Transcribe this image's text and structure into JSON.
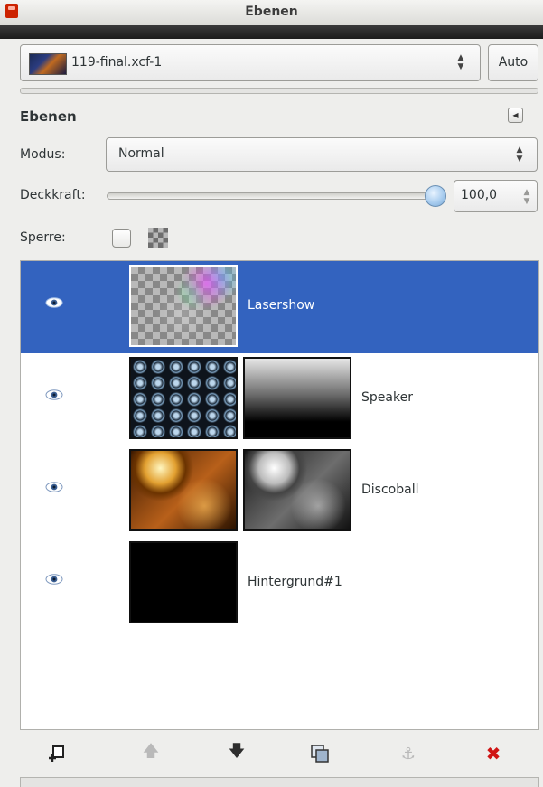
{
  "window": {
    "title": "Ebenen"
  },
  "image_selector": {
    "name": "119-final.xcf-1",
    "auto_label": "Auto"
  },
  "panel": {
    "title": "Ebenen",
    "mode": {
      "label": "Modus:",
      "value": "Normal"
    },
    "opacity": {
      "label": "Deckkraft:",
      "value": "100,0",
      "fraction": 1.0
    },
    "lock": {
      "label": "Sperre:"
    }
  },
  "layers": [
    {
      "name": "Lasershow",
      "selected": true,
      "visible": true,
      "has_mask": false
    },
    {
      "name": "Speaker",
      "selected": false,
      "visible": true,
      "has_mask": true
    },
    {
      "name": "Discoball",
      "selected": false,
      "visible": true,
      "has_mask": true
    },
    {
      "name": "Hintergrund#1",
      "selected": false,
      "visible": true,
      "has_mask": false
    }
  ],
  "toolbar": {
    "buttons": [
      {
        "icon": "new-layer-icon",
        "enabled": true
      },
      {
        "icon": "raise-layer-icon",
        "enabled": false
      },
      {
        "icon": "lower-layer-icon",
        "enabled": true
      },
      {
        "icon": "duplicate-layer-icon",
        "enabled": true
      },
      {
        "icon": "anchor-layer-icon",
        "enabled": false
      },
      {
        "icon": "delete-layer-icon",
        "enabled": true
      }
    ]
  },
  "colors": {
    "selection": "#3363bf",
    "delete": "#d01515"
  }
}
